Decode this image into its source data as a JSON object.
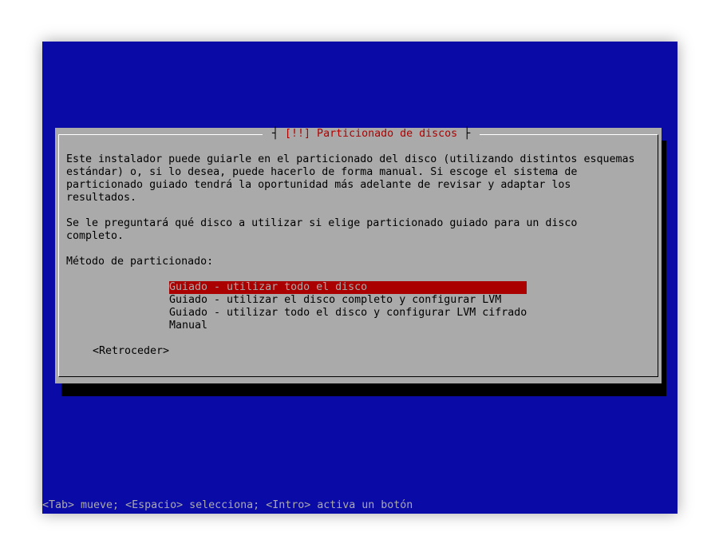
{
  "dialog": {
    "title": "[!!] Particionado de discos",
    "description": "Este instalador puede guiarle en el particionado del disco (utilizando distintos esquemas\nestándar) o, si lo desea, puede hacerlo de forma manual. Si escoge el sistema de\nparticionado guiado tendrá la oportunidad más adelante de revisar y adaptar los\nresultados.",
    "note": "Se le preguntará qué disco a utilizar si elige particionado guiado para un disco\ncompleto.",
    "prompt": "Método de particionado:",
    "options": [
      {
        "label": "Guiado - utilizar todo el disco",
        "selected": true
      },
      {
        "label": "Guiado - utilizar el disco completo y configurar LVM",
        "selected": false
      },
      {
        "label": "Guiado - utilizar todo el disco y configurar LVM cifrado",
        "selected": false
      },
      {
        "label": "Manual",
        "selected": false
      }
    ],
    "back_button": "<Retroceder>"
  },
  "status_bar": "<Tab> mueve; <Espacio> selecciona; <Intro> activa un botón",
  "colors": {
    "background": "#0a0aa6",
    "dialog": "#aaaaaa",
    "title": "#b00000",
    "selection": "#aa0000"
  }
}
